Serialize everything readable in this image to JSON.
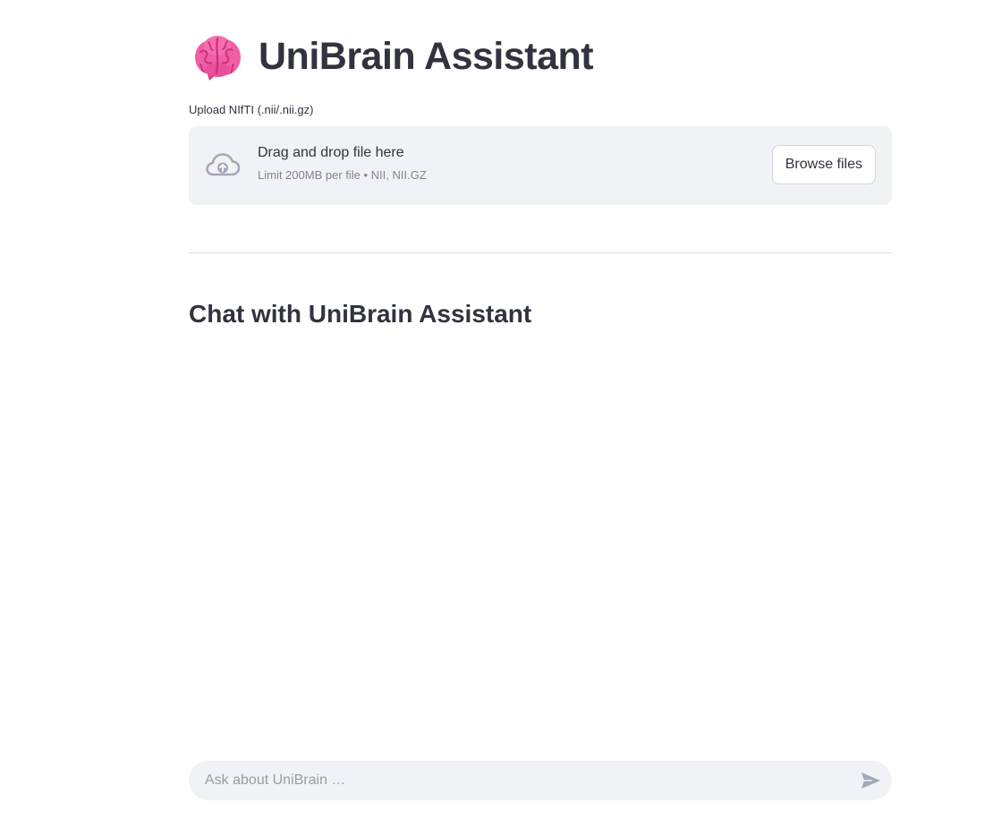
{
  "header": {
    "title": "UniBrain Assistant",
    "icon": "brain-emoji-icon"
  },
  "uploader": {
    "label": "Upload NIfTI (.nii/.nii.gz)",
    "dropzone_text": "Drag and drop file here",
    "limit_text": "Limit 200MB per file • NII, NII.GZ",
    "browse_label": "Browse files",
    "icon": "cloud-upload-icon"
  },
  "chat": {
    "heading": "Chat with UniBrain Assistant",
    "input_placeholder": "Ask about UniBrain …",
    "send_icon": "send-arrow-icon"
  },
  "colors": {
    "brain_pink": "#f25ea6",
    "surface": "#f0f2f6",
    "text": "#31333f",
    "muted": "#808495"
  }
}
